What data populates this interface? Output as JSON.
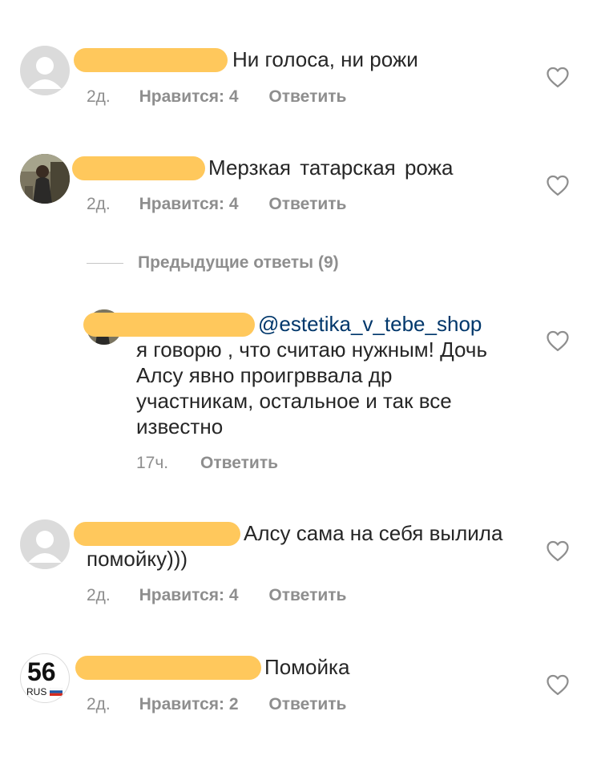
{
  "comments": [
    {
      "text": "Ни голоса, ни рожи",
      "age": "2д.",
      "likes": "Нравится: 4",
      "reply": "Ответить"
    },
    {
      "text": "Мерзкая  татарская  рожа",
      "age": "2д.",
      "likes": "Нравится: 4",
      "reply": "Ответить"
    },
    {
      "text": "Алсу сама на себя вылила помойку)))",
      "age": "2д.",
      "likes": "Нравится: 4",
      "reply": "Ответить"
    },
    {
      "text": "Помойка",
      "age": "2д.",
      "likes": "Нравится: 2",
      "reply": "Ответить",
      "avatar_number": "56",
      "avatar_region": "RUS"
    }
  ],
  "previous_replies": "Предыдущие ответы (9)",
  "reply_comment": {
    "mention": "@estetika_v_tebe_shop",
    "text": "я говорю , что считаю  нужным! Дочь Алсу  явно  проигрввала  др участникам, остальное  и так все известно",
    "age": "17ч.",
    "reply": "Ответить"
  },
  "icons": {
    "heart": "heart-outline-icon",
    "avatar": "default-avatar-icon"
  },
  "colors": {
    "redaction": "#ffc85c",
    "mention": "#00376b",
    "secondary_text": "#8e8e8e"
  }
}
